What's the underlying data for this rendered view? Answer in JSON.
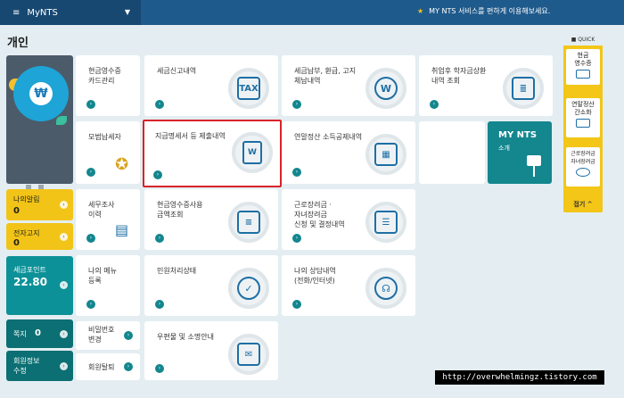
{
  "topbar": {
    "menu_icon": "hamburger-icon",
    "brand": "MyNTS",
    "notice_icon": "star-icon",
    "notice": "MY NTS 서비스를 편하게 이용해보세요."
  },
  "page_title": "개인",
  "side": {
    "mail": {
      "label": "나의알림",
      "value": "0"
    },
    "tax_notice": {
      "label": "전자고지",
      "value": "0"
    },
    "points": {
      "label": "세금포인트",
      "value": "22.80"
    },
    "note": {
      "label": "쪽지",
      "value": "0"
    },
    "member": {
      "label": "회원정보\n수정"
    }
  },
  "tiles": {
    "cash_receipt": "현금영수증\n카드관리",
    "tax_return": "세금신고내역",
    "payment": "세금납부, 환급, 고지\n체납내역",
    "student_loan": "취업후 학자금상환\n내역 조회",
    "model_taxpayer": "모범납세자",
    "statement": "지급명세서 등 제출내역",
    "year_end": "연말정산 소득공제내역",
    "audit": "세무조사\n이력",
    "cash_usage": "현금영수증사용\n금액조회",
    "earned_income": "근로장려금 ·\n자녀장려금\n신청 및 결정내역",
    "my_menu": "나의 메뉴\n등록",
    "civil": "민원처리상태",
    "consult": "나의 상담내역\n(전화/인터넷)",
    "password": "비밀번호\n변경",
    "withdraw": "회원탈퇴",
    "mail_notice": "우편물 및 소명안내"
  },
  "mynts": {
    "title": "MY NTS",
    "sub": "소개"
  },
  "quick": {
    "header": "QUICK",
    "items": [
      "현금\n영수증",
      "연말정산\n간소화",
      "근로장려금\n자녀장려금"
    ],
    "more": "접기 ^"
  },
  "watermark": "http://overwhelmingz.tistory.com"
}
